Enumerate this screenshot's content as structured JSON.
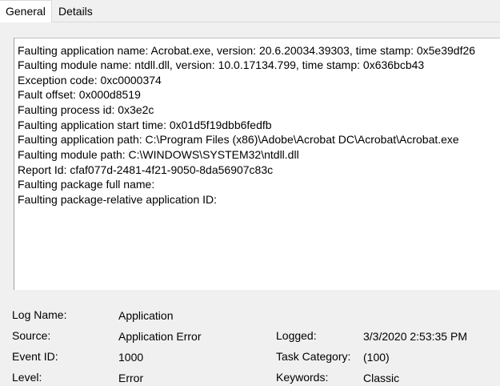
{
  "tabs": [
    {
      "label": "General",
      "active": true
    },
    {
      "label": "Details",
      "active": false
    }
  ],
  "message_lines": [
    "Faulting application name: Acrobat.exe, version: 20.6.20034.39303, time stamp: 0x5e39df26",
    "Faulting module name: ntdll.dll, version: 10.0.17134.799, time stamp: 0x636bcb43",
    "Exception code: 0xc0000374",
    "Fault offset: 0x000d8519",
    "Faulting process id: 0x3e2c",
    "Faulting application start time: 0x01d5f19dbb6fedfb",
    "Faulting application path: C:\\Program Files (x86)\\Adobe\\Acrobat DC\\Acrobat\\Acrobat.exe",
    "Faulting module path: C:\\WINDOWS\\SYSTEM32\\ntdll.dll",
    "Report Id: cfaf077d-2481-4f21-9050-8da56907c83c",
    "Faulting package full name:",
    "Faulting package-relative application ID:"
  ],
  "fields": {
    "log_name": {
      "label": "Log Name:",
      "value": "Application"
    },
    "source": {
      "label": "Source:",
      "value": "Application Error"
    },
    "logged": {
      "label": "Logged:",
      "value": "3/3/2020 2:53:35 PM"
    },
    "event_id": {
      "label": "Event ID:",
      "value": "1000"
    },
    "task_category": {
      "label": "Task Category:",
      "value": "(100)"
    },
    "level": {
      "label": "Level:",
      "value": "Error"
    },
    "keywords": {
      "label": "Keywords:",
      "value": "Classic"
    }
  }
}
